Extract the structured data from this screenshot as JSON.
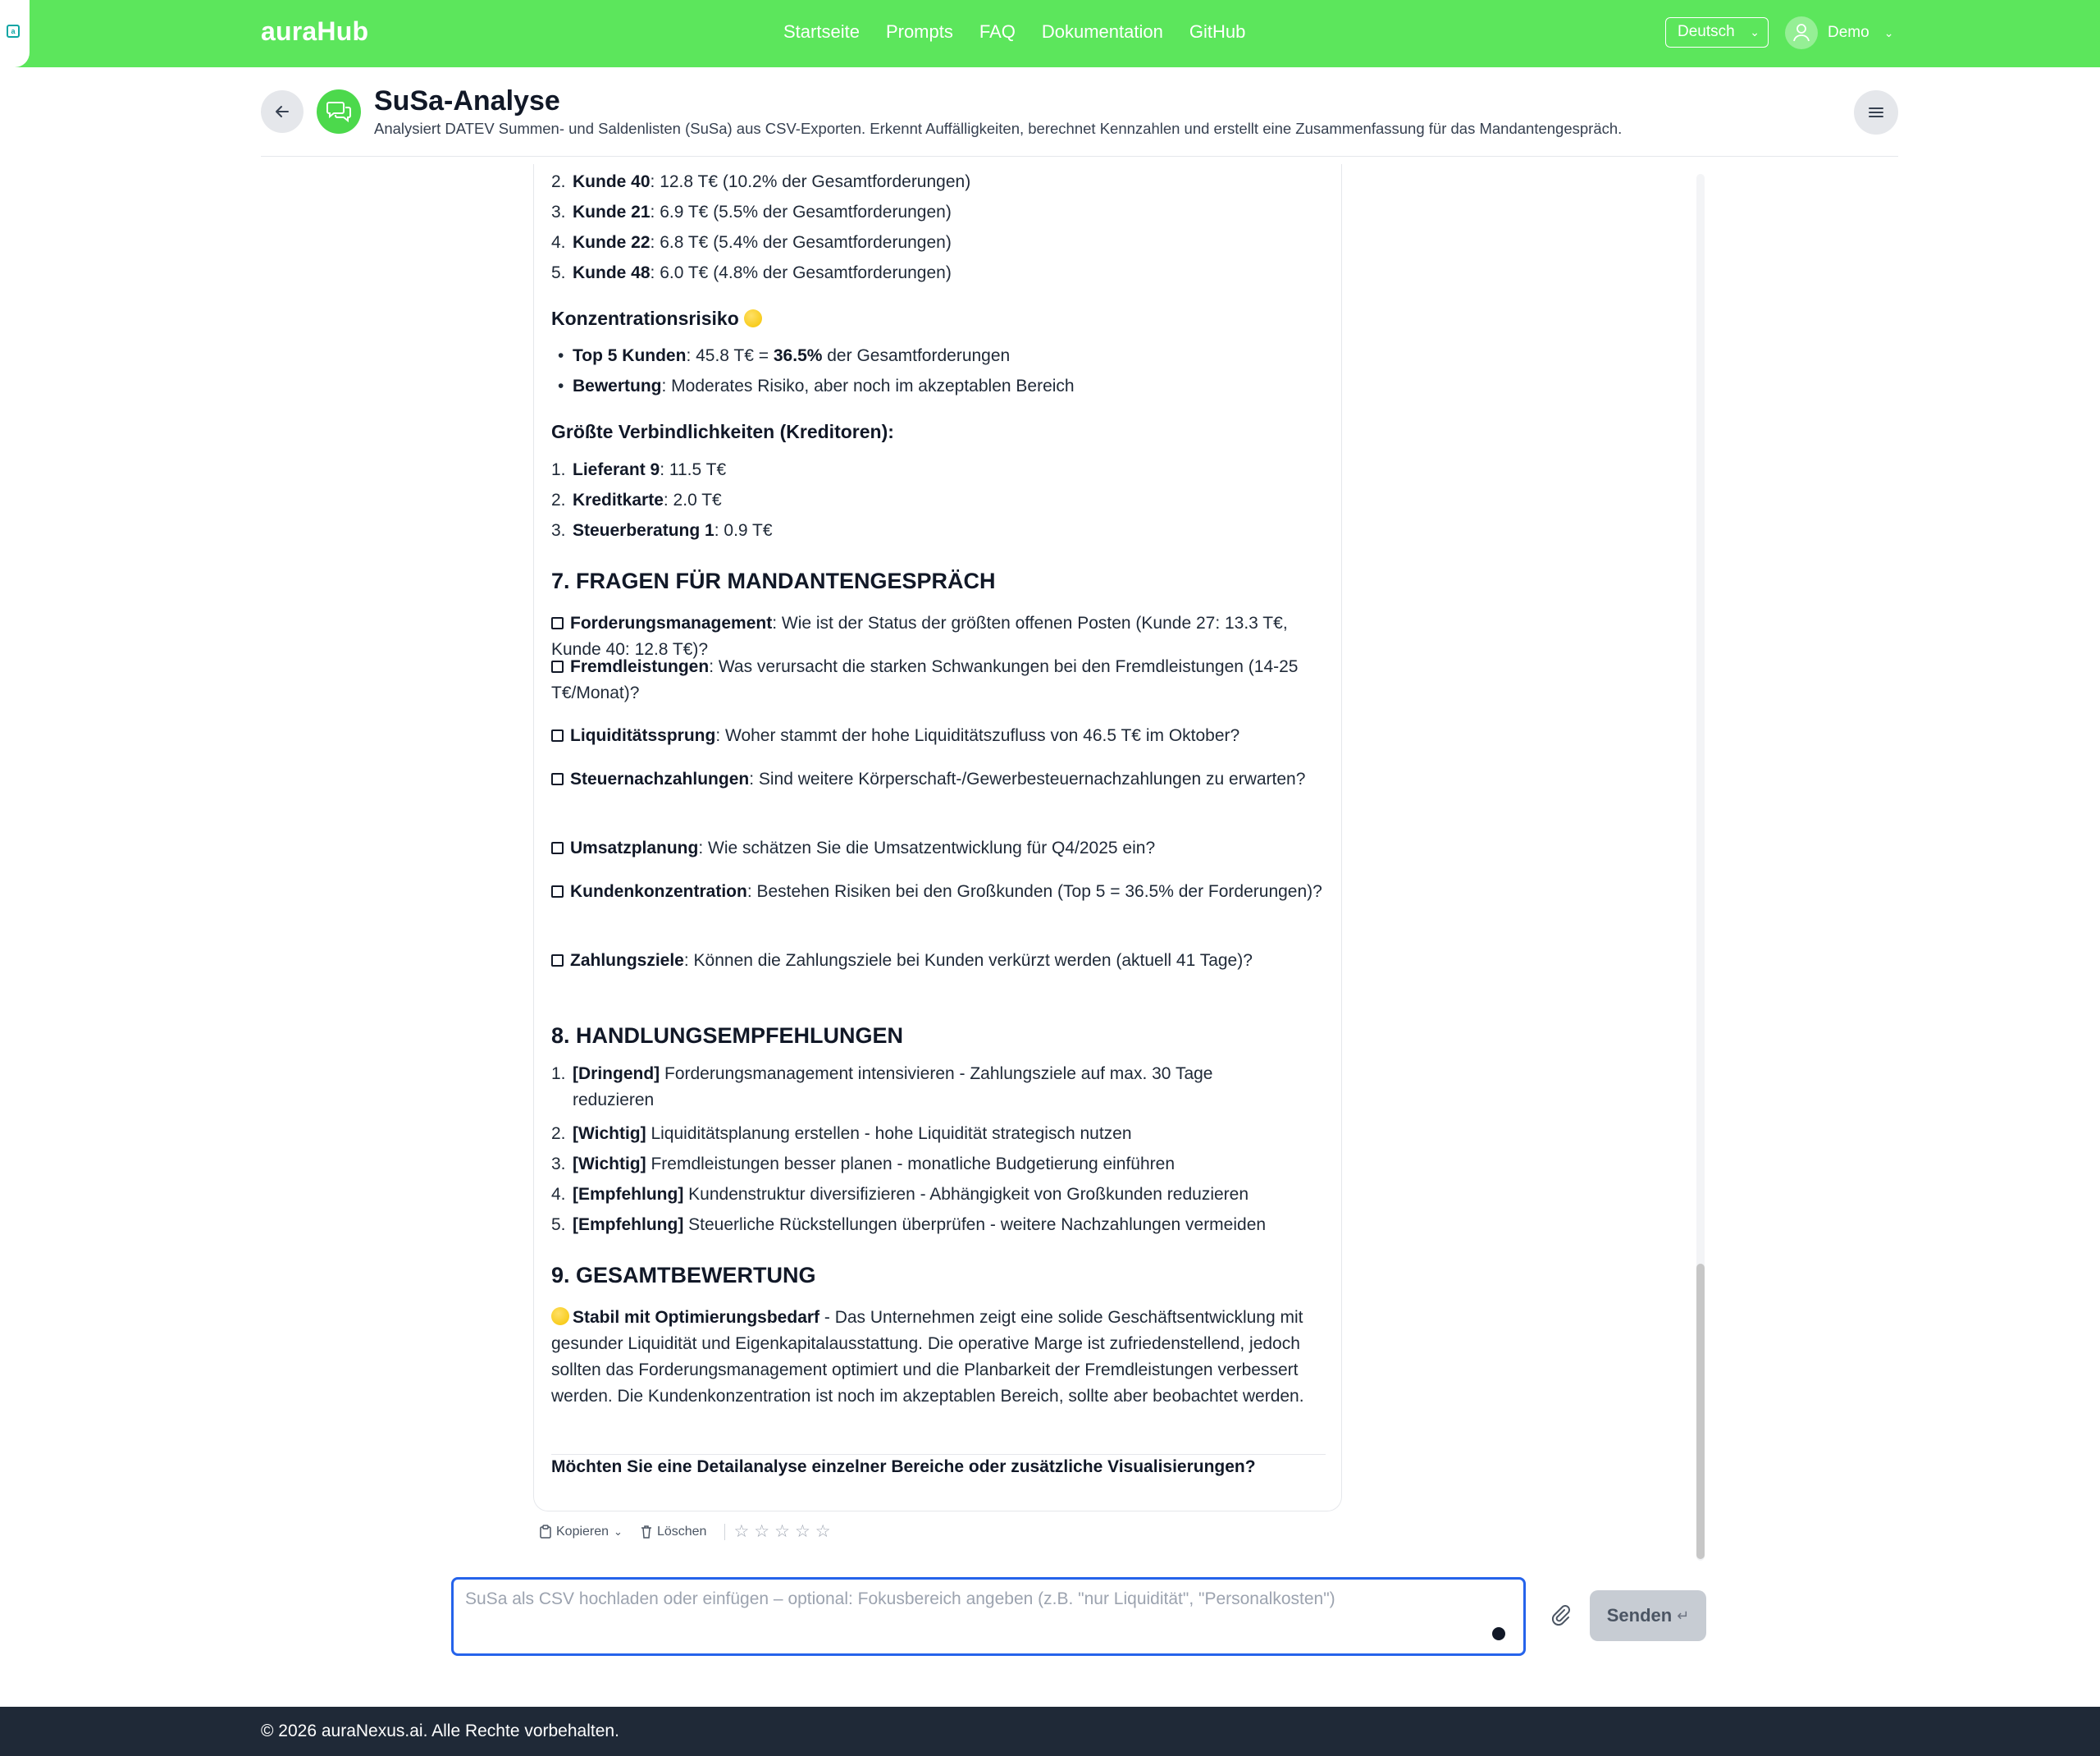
{
  "nav": {
    "brand": "auraHub",
    "links": [
      "Startseite",
      "Prompts",
      "FAQ",
      "Dokumentation",
      "GitHub"
    ],
    "language": "Deutsch",
    "user": "Demo"
  },
  "header": {
    "title": "SuSa-Analyse",
    "description": "Analysiert DATEV Summen- und Saldenlisten (SuSa) aus CSV-Exporten. Erkennt Auffälligkeiten, berechnet Kennzahlen und erstellt eine Zusammenfassung für das Mandantengespräch."
  },
  "message": {
    "top_customers": [
      {
        "n": "2.",
        "name": "Kunde 40",
        "rest": ": 12.8 T€ (10.2% der Gesamtforderungen)"
      },
      {
        "n": "3.",
        "name": "Kunde 21",
        "rest": ": 6.9 T€ (5.5% der Gesamtforderungen)"
      },
      {
        "n": "4.",
        "name": "Kunde 22",
        "rest": ": 6.8 T€ (5.4% der Gesamtforderungen)"
      },
      {
        "n": "5.",
        "name": "Kunde 48",
        "rest": ": 6.0 T€ (4.8% der Gesamtforderungen)"
      }
    ],
    "risk_heading": "Konzentrationsrisiko",
    "risk_items": [
      {
        "label": "Top 5 Kunden",
        "mid": ": 45.8 T€ = ",
        "strong": "36.5%",
        "rest": " der Gesamtforderungen"
      },
      {
        "label": "Bewertung",
        "rest": ": Moderates Risiko, aber noch im akzeptablen Bereich"
      }
    ],
    "creditors_heading": "Größte Verbindlichkeiten (Kreditoren):",
    "creditors": [
      {
        "n": "1.",
        "name": "Lieferant 9",
        "rest": ": 11.5 T€"
      },
      {
        "n": "2.",
        "name": "Kreditkarte",
        "rest": ": 2.0 T€"
      },
      {
        "n": "3.",
        "name": "Steuerberatung 1",
        "rest": ": 0.9 T€"
      }
    ],
    "questions_heading": "7. FRAGEN FÜR MANDANTENGESPRÄCH",
    "questions": [
      {
        "label": "Forderungsmanagement",
        "rest": ": Wie ist der Status der größten offenen Posten (Kunde 27: 13.3 T€, Kunde 40: 12.8 T€)?"
      },
      {
        "label": "Fremdleistungen",
        "rest": ": Was verursacht die starken Schwankungen bei den Fremdleistungen (14-25 T€/Monat)?"
      },
      {
        "label": "Liquiditätssprung",
        "rest": ": Woher stammt der hohe Liquiditätszufluss von 46.5 T€ im Oktober?"
      },
      {
        "label": "Steuernachzahlungen",
        "rest": ": Sind weitere Körperschaft-/Gewerbesteuernachzahlungen zu erwarten?"
      },
      {
        "label": "Umsatzplanung",
        "rest": ": Wie schätzen Sie die Umsatzentwicklung für Q4/2025 ein?"
      },
      {
        "label": "Kundenkonzentration",
        "rest": ": Bestehen Risiken bei den Großkunden (Top 5 = 36.5% der Forderungen)?"
      },
      {
        "label": "Zahlungsziele",
        "rest": ": Können die Zahlungsziele bei Kunden verkürzt werden (aktuell 41 Tage)?"
      }
    ],
    "recommend_heading": "8. HANDLUNGSEMPFEHLUNGEN",
    "recommendations": [
      {
        "n": "1.",
        "tag": "[Dringend]",
        "rest": " Forderungsmanagement intensivieren - Zahlungsziele auf max. 30 Tage",
        "rest2": "reduzieren"
      },
      {
        "n": "2.",
        "tag": "[Wichtig]",
        "rest": " Liquiditätsplanung erstellen - hohe Liquidität strategisch nutzen"
      },
      {
        "n": "3.",
        "tag": "[Wichtig]",
        "rest": " Fremdleistungen besser planen - monatliche Budgetierung einführen"
      },
      {
        "n": "4.",
        "tag": "[Empfehlung]",
        "rest": " Kundenstruktur diversifizieren - Abhängigkeit von Großkunden reduzieren"
      },
      {
        "n": "5.",
        "tag": "[Empfehlung]",
        "rest": " Steuerliche Rückstellungen überprüfen - weitere Nachzahlungen vermeiden"
      }
    ],
    "overall_heading": "9. GESAMTBEWERTUNG",
    "overall_label": "Stabil mit Optimierungsbedarf",
    "overall_text": " - Das Unternehmen zeigt eine solide Geschäftsentwicklung mit gesunder Liquidität und Eigenkapitalausstattung. Die operative Marge ist zufriedenstellend, jedoch sollten das Forderungsmanagement optimiert und die Planbarkeit der Fremdleistungen verbessert werden. Die Kundenkonzentration ist noch im akzeptablen Bereich, sollte aber beobachtet werden.",
    "closing_question": "Möchten Sie eine Detailanalyse einzelner Bereiche oder zusätzliche Visualisierungen?"
  },
  "actions": {
    "copy": "Kopieren",
    "delete": "Löschen",
    "rating_max": 5,
    "rating_value": 0
  },
  "composer": {
    "placeholder": "SuSa als CSV hochladen oder einfügen – optional: Fokusbereich angeben (z.B. \"nur Liquidität\", \"Personalkosten\")",
    "send": "Senden",
    "send_hint": "↵"
  },
  "footer": {
    "copyright": "© 2026 auraNexus.ai. Alle Rechte vorbehalten."
  },
  "colors": {
    "brand_green": "#5ce65c",
    "focus_blue": "#2563eb",
    "footer_bg": "#1f2937"
  }
}
